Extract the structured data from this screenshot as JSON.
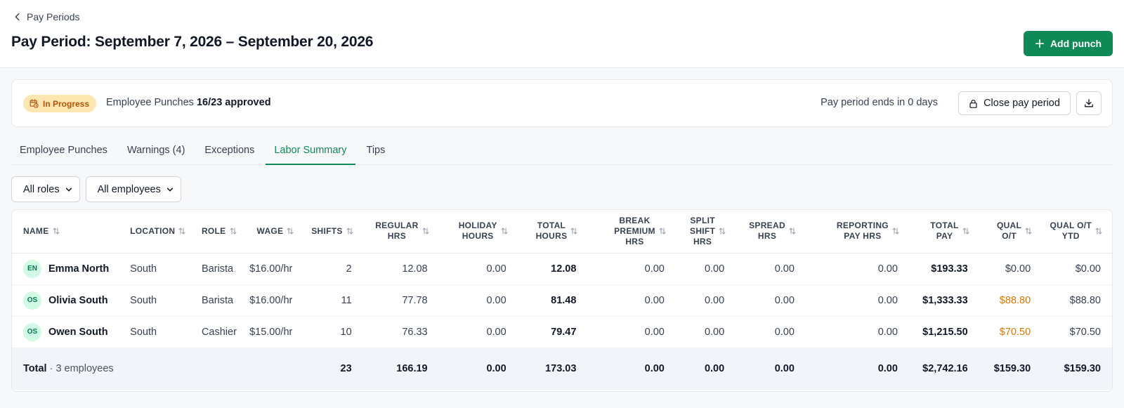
{
  "header": {
    "back_label": "Pay Periods",
    "title": "Pay Period: September 7, 2026 – September 20, 2026",
    "add_punch_label": "Add punch"
  },
  "status": {
    "badge": "In Progress",
    "punches_label": "Employee Punches",
    "punches_count": "16/23 approved",
    "ends_text": "Pay period ends in 0 days",
    "close_label": "Close pay period"
  },
  "tabs": [
    {
      "label": "Employee Punches",
      "active": false
    },
    {
      "label": "Warnings (4)",
      "active": false
    },
    {
      "label": "Exceptions",
      "active": false
    },
    {
      "label": "Labor Summary",
      "active": true
    },
    {
      "label": "Tips",
      "active": false
    }
  ],
  "filters": {
    "roles": "All roles",
    "employees": "All employees"
  },
  "columns": [
    {
      "lines": [
        "Name"
      ],
      "align": "left"
    },
    {
      "lines": [
        "Location"
      ],
      "align": "left"
    },
    {
      "lines": [
        "Role"
      ],
      "align": "left"
    },
    {
      "lines": [
        "Wage"
      ],
      "align": "right"
    },
    {
      "lines": [
        "Shifts"
      ],
      "align": "right"
    },
    {
      "lines": [
        "Regular",
        "Hrs"
      ],
      "align": "right"
    },
    {
      "lines": [
        "Holiday",
        "Hours"
      ],
      "align": "right"
    },
    {
      "lines": [
        "Total",
        "Hours"
      ],
      "align": "right"
    },
    {
      "lines": [
        "Break",
        "Premium",
        "Hrs"
      ],
      "align": "right"
    },
    {
      "lines": [
        "Split",
        "Shift",
        "Hrs"
      ],
      "align": "right"
    },
    {
      "lines": [
        "Spread",
        "Hrs"
      ],
      "align": "right"
    },
    {
      "lines": [
        "Reporting",
        "Pay Hrs"
      ],
      "align": "right"
    },
    {
      "lines": [
        "Total",
        "Pay"
      ],
      "align": "right"
    },
    {
      "lines": [
        "Qual",
        "O/T"
      ],
      "align": "right"
    },
    {
      "lines": [
        "Qual O/T",
        "YTD"
      ],
      "align": "right"
    }
  ],
  "rows": [
    {
      "initials": "EN",
      "name": "Emma North",
      "location": "South",
      "role": "Barista",
      "wage": "$16.00/hr",
      "shifts": "2",
      "regular_hrs": "12.08",
      "holiday_hours": "0.00",
      "total_hours": "12.08",
      "break_premium_hrs": "0.00",
      "split_shift_hrs": "0.00",
      "spread_hrs": "0.00",
      "reporting_pay_hrs": "0.00",
      "total_pay": "$193.33",
      "qual_ot": "$0.00",
      "qual_ot_highlight": false,
      "qual_ot_ytd": "$0.00"
    },
    {
      "initials": "OS",
      "name": "Olivia South",
      "location": "South",
      "role": "Barista",
      "wage": "$16.00/hr",
      "shifts": "11",
      "regular_hrs": "77.78",
      "holiday_hours": "0.00",
      "total_hours": "81.48",
      "break_premium_hrs": "0.00",
      "split_shift_hrs": "0.00",
      "spread_hrs": "0.00",
      "reporting_pay_hrs": "0.00",
      "total_pay": "$1,333.33",
      "qual_ot": "$88.80",
      "qual_ot_highlight": true,
      "qual_ot_ytd": "$88.80"
    },
    {
      "initials": "OS",
      "name": "Owen South",
      "location": "South",
      "role": "Cashier",
      "wage": "$15.00/hr",
      "shifts": "10",
      "regular_hrs": "76.33",
      "holiday_hours": "0.00",
      "total_hours": "79.47",
      "break_premium_hrs": "0.00",
      "split_shift_hrs": "0.00",
      "spread_hrs": "0.00",
      "reporting_pay_hrs": "0.00",
      "total_pay": "$1,215.50",
      "qual_ot": "$70.50",
      "qual_ot_highlight": true,
      "qual_ot_ytd": "$70.50"
    }
  ],
  "totals": {
    "label": "Total",
    "count": "· 3 employees",
    "shifts": "23",
    "regular_hrs": "166.19",
    "holiday_hours": "0.00",
    "total_hours": "173.03",
    "break_premium_hrs": "0.00",
    "split_shift_hrs": "0.00",
    "spread_hrs": "0.00",
    "reporting_pay_hrs": "0.00",
    "total_pay": "$2,742.16",
    "qual_ot": "$159.30",
    "qual_ot_ytd": "$159.30"
  },
  "colors": {
    "accent": "#0f8a56",
    "badge_bg": "#fde6b0",
    "badge_text": "#b45309",
    "overtime": "#d97706"
  }
}
